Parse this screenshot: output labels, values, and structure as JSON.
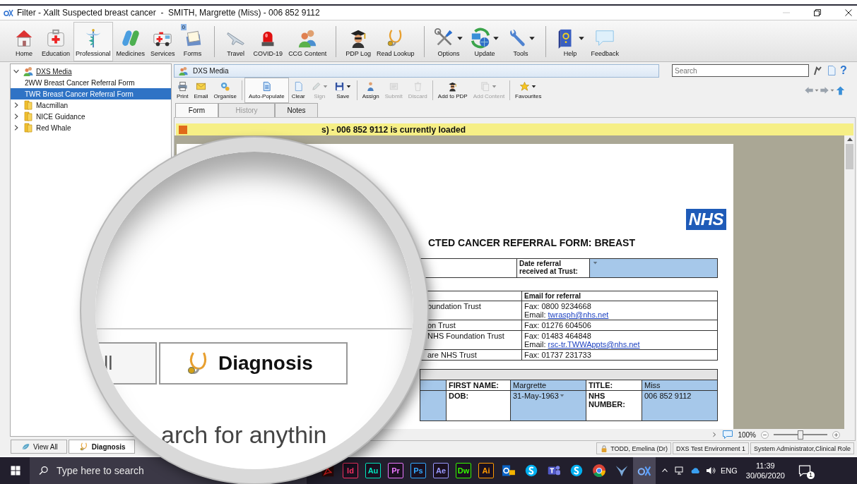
{
  "window": {
    "title": "Filter - Xallt Suspected breast cancer  -  SMITH, Margrette (Miss) - 006 852 9112"
  },
  "ribbon": {
    "groups": [
      {
        "items": [
          {
            "label": "Home",
            "selected": false,
            "dropdown": false
          },
          {
            "label": "Education",
            "selected": false,
            "dropdown": false
          },
          {
            "label": "Professional",
            "selected": true,
            "dropdown": false
          },
          {
            "label": "Medicines",
            "selected": false,
            "dropdown": false
          },
          {
            "label": "Services",
            "selected": false,
            "dropdown": false
          },
          {
            "label": "Forms",
            "selected": false,
            "dropdown": false,
            "badge": "0"
          }
        ]
      },
      {
        "items": [
          {
            "label": "Travel",
            "selected": false,
            "dropdown": false
          },
          {
            "label": "COVID-19",
            "selected": false,
            "dropdown": false
          },
          {
            "label": "CCG Content",
            "selected": false,
            "dropdown": false
          }
        ]
      },
      {
        "items": [
          {
            "label": "PDP Log",
            "selected": false,
            "dropdown": false
          },
          {
            "label": "Read Lookup",
            "selected": false,
            "dropdown": false
          }
        ]
      },
      {
        "items": [
          {
            "label": "Options",
            "selected": false,
            "dropdown": true
          },
          {
            "label": "Update",
            "selected": false,
            "dropdown": true
          },
          {
            "label": "Tools",
            "selected": false,
            "dropdown": true
          }
        ]
      },
      {
        "items": [
          {
            "label": "Help",
            "selected": false,
            "dropdown": true
          },
          {
            "label": "Feedback",
            "selected": false,
            "dropdown": false
          }
        ]
      }
    ]
  },
  "navigator": {
    "tree": [
      {
        "label": "DXS Media",
        "expanded": true,
        "selected": false,
        "children": [
          {
            "label": "2WW Breast Cancer Referral Form",
            "selected": false
          },
          {
            "label": "TWR Breast Cancer Referral Form",
            "selected": true
          }
        ]
      },
      {
        "label": "Macmillan",
        "expanded": false,
        "selected": false
      },
      {
        "label": "NICE Guidance",
        "expanded": false,
        "selected": false
      },
      {
        "label": "Red Whale",
        "expanded": false,
        "selected": false
      }
    ],
    "tabs": [
      {
        "label": "View All",
        "selected": false
      },
      {
        "label": "Diagnosis",
        "selected": true
      }
    ]
  },
  "header": {
    "title": "DXS Media"
  },
  "search": {
    "placeholder": "Search"
  },
  "help_glyph": "?",
  "toolbar": {
    "groups": [
      {
        "items": [
          {
            "label": "Print",
            "selected": false,
            "disabled": false,
            "dropdown": false
          },
          {
            "label": "Email",
            "selected": false,
            "disabled": false,
            "dropdown": false
          },
          {
            "label": "Organise",
            "selected": false,
            "disabled": false,
            "dropdown": false
          }
        ]
      },
      {
        "items": [
          {
            "label": "Auto-Populate",
            "selected": true,
            "disabled": false,
            "dropdown": false
          },
          {
            "label": "Clear",
            "selected": false,
            "disabled": false,
            "dropdown": false
          },
          {
            "label": "Sign",
            "selected": false,
            "disabled": true,
            "dropdown": true
          },
          {
            "label": "Save",
            "selected": false,
            "disabled": false,
            "dropdown": true
          }
        ]
      },
      {
        "items": [
          {
            "label": "Assign",
            "selected": false,
            "disabled": false,
            "dropdown": false
          },
          {
            "label": "Submit",
            "selected": false,
            "disabled": true,
            "dropdown": false
          },
          {
            "label": "Discard",
            "selected": false,
            "disabled": true,
            "dropdown": false
          }
        ]
      },
      {
        "items": [
          {
            "label": "Add to PDP",
            "selected": false,
            "disabled": false,
            "dropdown": false
          },
          {
            "label": "Add Content",
            "selected": false,
            "disabled": true,
            "dropdown": true
          }
        ]
      },
      {
        "items": [
          {
            "label": "Favourites",
            "selected": false,
            "disabled": false,
            "dropdown": true
          }
        ]
      }
    ]
  },
  "doc_tabs": [
    {
      "label": "Form",
      "selected": true,
      "disabled": false
    },
    {
      "label": "History",
      "selected": false,
      "disabled": true
    },
    {
      "label": "Notes",
      "selected": false,
      "disabled": false
    }
  ],
  "banner": {
    "text": "s) - 006 852 9112 is currently loaded"
  },
  "form": {
    "logo": "NHS",
    "title": "CTED CANCER REFERRAL FORM: BREAST",
    "date_label": "Date referral received at Trust:",
    "contacts": {
      "header": "Email for referral",
      "rows": [
        {
          "trust": "oundation Trust",
          "fax": "Fax: 0800 9234668",
          "email_label": "Email:",
          "email": "twrasph@nhs.net"
        },
        {
          "trust": "on Trust",
          "fax": "Fax: 01276 604506"
        },
        {
          "trust": "NHS Foundation Trust",
          "fax": "Fax: 01483 464848",
          "email_label": "Email:",
          "email": "rsc-tr.TWWAppts@nhs.net"
        },
        {
          "trust": "are NHS Trust",
          "fax": "Fax: 01737 231733"
        }
      ]
    },
    "patient": {
      "rows": [
        [
          {
            "label": "FIRST NAME:",
            "value": "Margrette",
            "dropdown": false
          },
          {
            "label": "TITLE:",
            "value": "Miss",
            "dropdown": false
          }
        ],
        [
          {
            "label": "DOB:",
            "value": "31-May-1963",
            "dropdown": true
          },
          {
            "label": "NHS NUMBER:",
            "value": "006 852 9112",
            "dropdown": false
          }
        ]
      ]
    }
  },
  "zoom": {
    "percent": "100%",
    "level": 0.5
  },
  "status_bar": [
    "TODD, Emelina (Dr)",
    "DXS Test Environment 1",
    "System Administrator,Clinical Role"
  ],
  "magnifier": {
    "tabs": [
      {
        "label": "ll",
        "selected": false
      },
      {
        "label": "Diagnosis",
        "selected": true
      }
    ],
    "search_text": "arch for anythin"
  },
  "taskbar": {
    "search": {
      "placeholder": "Type here to search"
    },
    "apps": [
      {
        "kind": "icon",
        "selected": false
      },
      {
        "kind": "letter",
        "label": "Id",
        "color": "#ff3366",
        "selected": false
      },
      {
        "kind": "letter",
        "label": "Au",
        "color": "#00e4bb",
        "selected": false
      },
      {
        "kind": "letter",
        "label": "Pr",
        "color": "#ea77ff",
        "selected": false
      },
      {
        "kind": "letter",
        "label": "Ps",
        "color": "#31a8ff",
        "selected": false
      },
      {
        "kind": "letter",
        "label": "Ae",
        "color": "#9999ff",
        "selected": false
      },
      {
        "kind": "letter",
        "label": "Dw",
        "color": "#35fa00",
        "selected": false
      },
      {
        "kind": "letter",
        "label": "Ai",
        "color": "#ff9a00",
        "selected": false
      },
      {
        "kind": "icon",
        "selected": false
      },
      {
        "kind": "icon",
        "selected": false
      },
      {
        "kind": "icon",
        "selected": false
      },
      {
        "kind": "icon",
        "selected": false
      },
      {
        "kind": "icon",
        "selected": false
      },
      {
        "kind": "icon",
        "selected": false
      },
      {
        "kind": "icon",
        "selected": true
      }
    ],
    "language": "ENG",
    "time": "11:39",
    "date": "30/06/2020",
    "notifications": "1"
  }
}
